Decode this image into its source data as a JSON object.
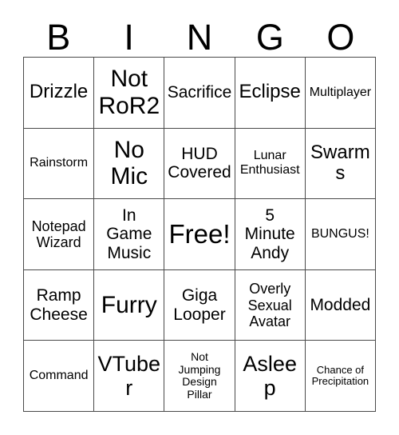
{
  "card": {
    "title": "BINGO",
    "header_letters": [
      "B",
      "I",
      "N",
      "G",
      "O"
    ],
    "background_color": "#ffffff",
    "text_color": "#000000",
    "grid_line_color": "#4a4a4a",
    "rows": 5,
    "columns": 5,
    "free_space": "Free!",
    "free_space_position": "center",
    "cells": [
      [
        {
          "text": "Drizzle",
          "size": "lg"
        },
        {
          "text": "Not\nRoR2",
          "size": "xxl"
        },
        {
          "text": "Sacrifice",
          "size": "md"
        },
        {
          "text": "Eclipse",
          "size": "lg"
        },
        {
          "text": "Multiplayer",
          "size": "xs"
        }
      ],
      [
        {
          "text": "Rainstorm",
          "size": "xs"
        },
        {
          "text": "No\nMic",
          "size": "xxl"
        },
        {
          "text": "HUD\nCovered",
          "size": "md"
        },
        {
          "text": "Lunar\nEnthusiast",
          "size": "xs"
        },
        {
          "text": "Swarms",
          "size": "lg"
        }
      ],
      [
        {
          "text": "Notepad\nWizard",
          "size": "sm"
        },
        {
          "text": "In\nGame\nMusic",
          "size": "md"
        },
        {
          "text": "Free!",
          "size": "free"
        },
        {
          "text": "5\nMinute\nAndy",
          "size": "md"
        },
        {
          "text": "BUNGUS!",
          "size": "xs"
        }
      ],
      [
        {
          "text": "Ramp\nCheese",
          "size": "md"
        },
        {
          "text": "Furry",
          "size": "xxl"
        },
        {
          "text": "Giga\nLooper",
          "size": "md"
        },
        {
          "text": "Overly\nSexual\nAvatar",
          "size": "sm"
        },
        {
          "text": "Modded",
          "size": "md"
        }
      ],
      [
        {
          "text": "Command",
          "size": "xs"
        },
        {
          "text": "VTuber",
          "size": "xl"
        },
        {
          "text": "Not\nJumping\nDesign\nPillar",
          "size": "xxs"
        },
        {
          "text": "Asleep",
          "size": "xl"
        },
        {
          "text": "Chance of\nPrecipitation",
          "size": "tiny"
        }
      ]
    ]
  }
}
